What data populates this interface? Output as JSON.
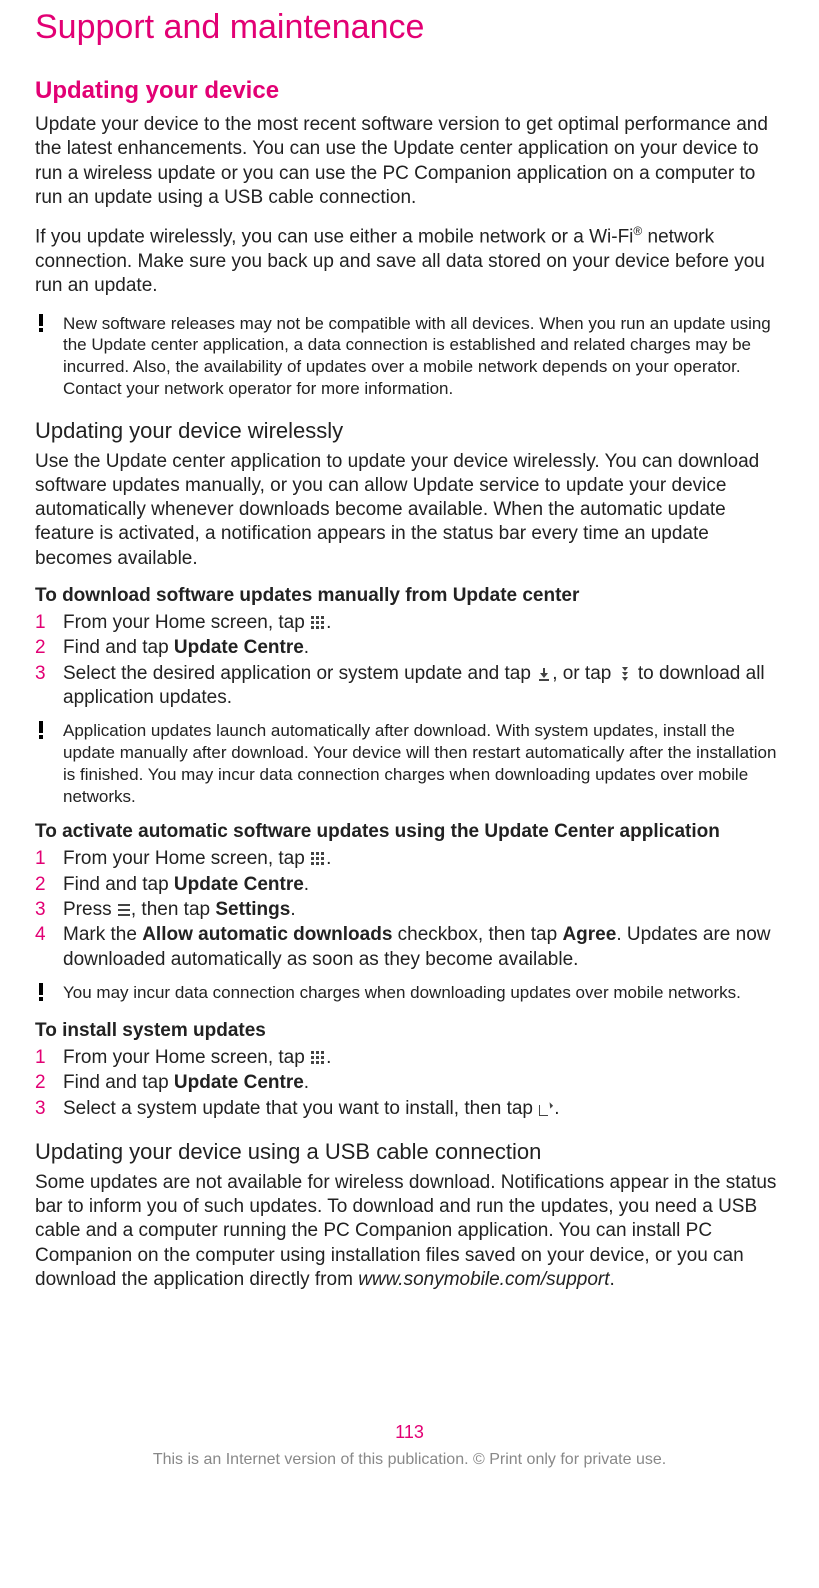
{
  "title": "Support and maintenance",
  "section_update_device": {
    "heading": "Updating your device",
    "p1": "Update your device to the most recent software version to get optimal performance and the latest enhancements. You can use the Update center application on your device to run a wireless update or you can use the PC Companion application on a computer to run an update using a USB cable connection.",
    "p2_a": "If you update wirelessly, you can use either a mobile network or a Wi-Fi",
    "p2_sup": "®",
    "p2_b": " network connection. Make sure you back up and save all data stored on your device before you run an update.",
    "note1": "New software releases may not be compatible with all devices. When you run an update using the Update center application, a data connection is established and related charges may be incurred. Also, the availability of updates over a mobile network depends on your operator. Contact your network operator for more information."
  },
  "section_wireless": {
    "heading": "Updating your device wirelessly",
    "p1": "Use the Update center application to update your device wirelessly. You can download software updates manually, or you can allow Update service to update your device automatically whenever downloads become available. When the automatic update feature is activated, a notification appears in the status bar every time an update becomes available."
  },
  "task_download_manual": {
    "heading": "To download software updates manually from Update center",
    "steps": [
      {
        "num": "1",
        "a": "From your Home screen, tap ",
        "b": "."
      },
      {
        "num": "2",
        "a": "Find and tap ",
        "bold": "Update Centre",
        "b": "."
      },
      {
        "num": "3",
        "a": "Select the desired application or system update and tap ",
        "mid": ", or tap ",
        "b": " to download all application updates."
      }
    ],
    "note": "Application updates launch automatically after download. With system updates, install the update manually after download. Your device will then restart automatically after the installation is finished. You may incur data connection charges when downloading updates over mobile networks."
  },
  "task_auto_updates": {
    "heading": "To activate automatic software updates using the Update Center application",
    "steps": [
      {
        "num": "1",
        "a": "From your Home screen, tap ",
        "b": "."
      },
      {
        "num": "2",
        "a": "Find and tap ",
        "bold": "Update Centre",
        "b": "."
      },
      {
        "num": "3",
        "a": "Press ",
        "mid": ", then tap ",
        "bold": "Settings",
        "b": "."
      },
      {
        "num": "4",
        "a": "Mark the ",
        "bold": "Allow automatic downloads",
        "mid": " checkbox, then tap ",
        "bold2": "Agree",
        "b": ". Updates are now downloaded automatically as soon as they become available."
      }
    ],
    "note": "You may incur data connection charges when downloading updates over mobile networks."
  },
  "task_install_system": {
    "heading": "To install system updates",
    "steps": [
      {
        "num": "1",
        "a": "From your Home screen, tap ",
        "b": "."
      },
      {
        "num": "2",
        "a": "Find and tap ",
        "bold": "Update Centre",
        "b": "."
      },
      {
        "num": "3",
        "a": "Select a system update that you want to install, then tap ",
        "b": "."
      }
    ]
  },
  "section_usb": {
    "heading": "Updating your device using a USB cable connection",
    "p1_a": "Some updates are not available for wireless download. Notifications appear in the status bar to inform you of such updates. To download and run the updates, you need a USB cable and a computer running the PC Companion application. You can install PC Companion on the computer using installation files saved on your device, or you can download the application directly from ",
    "p1_link": "www.sonymobile.com/support",
    "p1_b": "."
  },
  "footer": {
    "page": "113",
    "text": "This is an Internet version of this publication. © Print only for private use."
  }
}
